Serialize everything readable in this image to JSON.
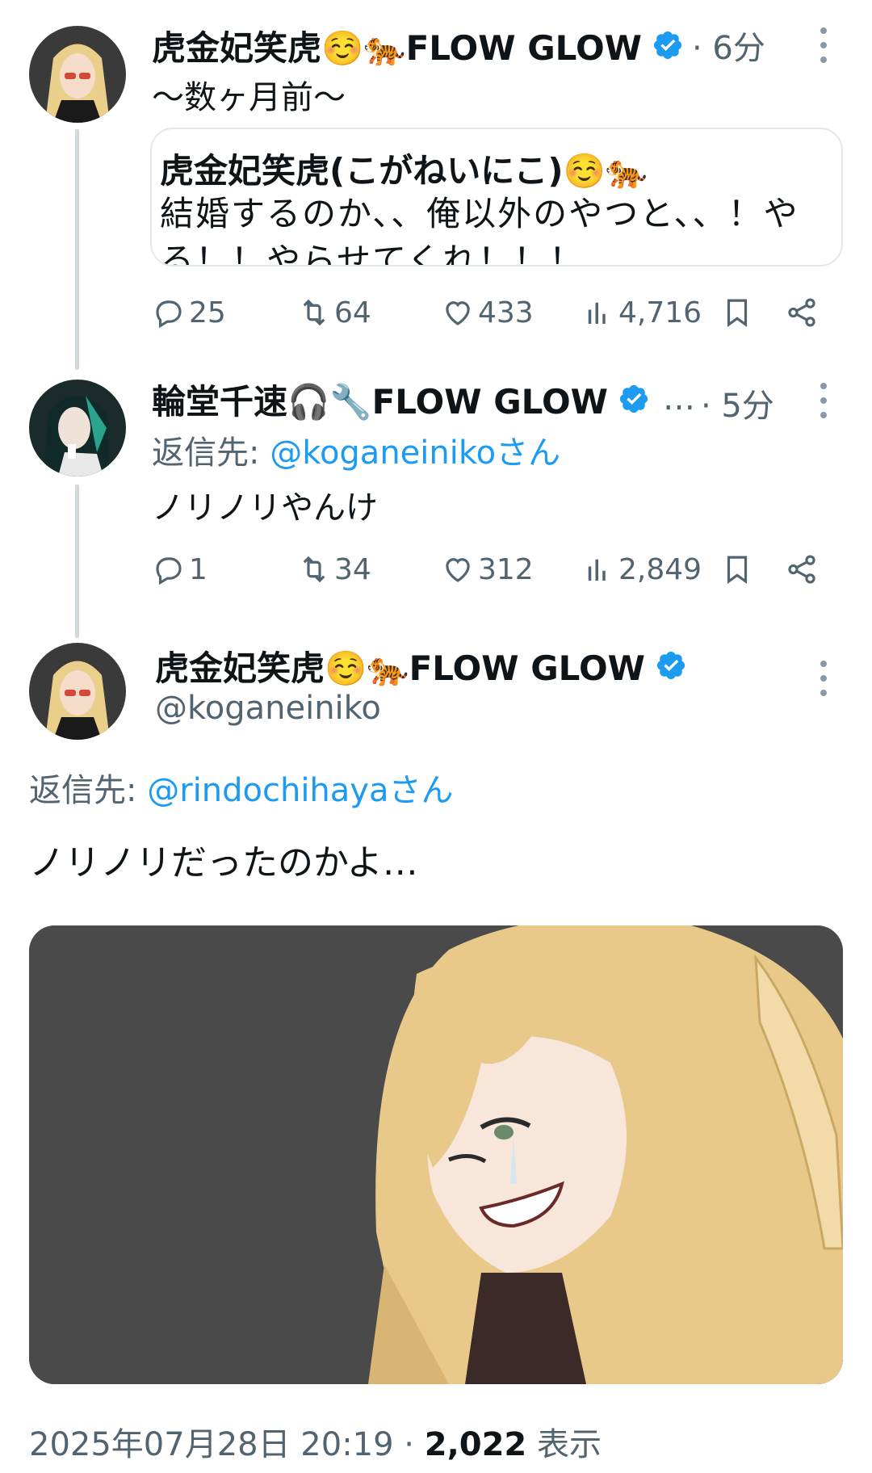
{
  "tweet1": {
    "display_name": "虎金妃笑虎☺️🐅FLOW GLOW",
    "time": "· 6分",
    "text": "〜数ヶ月前〜",
    "quote": {
      "name": "虎金妃笑虎(こがねいにこ)☺️🐅",
      "body": "結婚するのか、、俺以外のやつと、、！やる！！やらせてくれ！！！"
    },
    "actions": {
      "replies": "25",
      "retweets": "64",
      "likes": "433",
      "views": "4,716"
    }
  },
  "tweet2": {
    "display_name": "輪堂千速🎧🔧FLOW GLOW",
    "ellipsis": "…",
    "time": "· 5分",
    "reply_prefix": "返信先: ",
    "reply_handle": "@koganeinikoさん",
    "text": "ノリノリやんけ",
    "actions": {
      "replies": "1",
      "retweets": "34",
      "likes": "312",
      "views": "2,849"
    }
  },
  "tweet3": {
    "display_name": "虎金妃笑虎☺️🐅FLOW GLOW",
    "handle": "@koganeiniko",
    "reply_prefix": "返信先: ",
    "reply_handle": "@rindochihayaさん",
    "text": "ノリノリだったのかよ…",
    "timestamp": "2025年07月28日 20:19 · ",
    "views": "2,022",
    "views_label": " 表示"
  },
  "colors": {
    "verified": "#1d9bf0",
    "link": "#1d9bf0",
    "muted": "#536471",
    "media_bg": "#4a4a4a"
  }
}
